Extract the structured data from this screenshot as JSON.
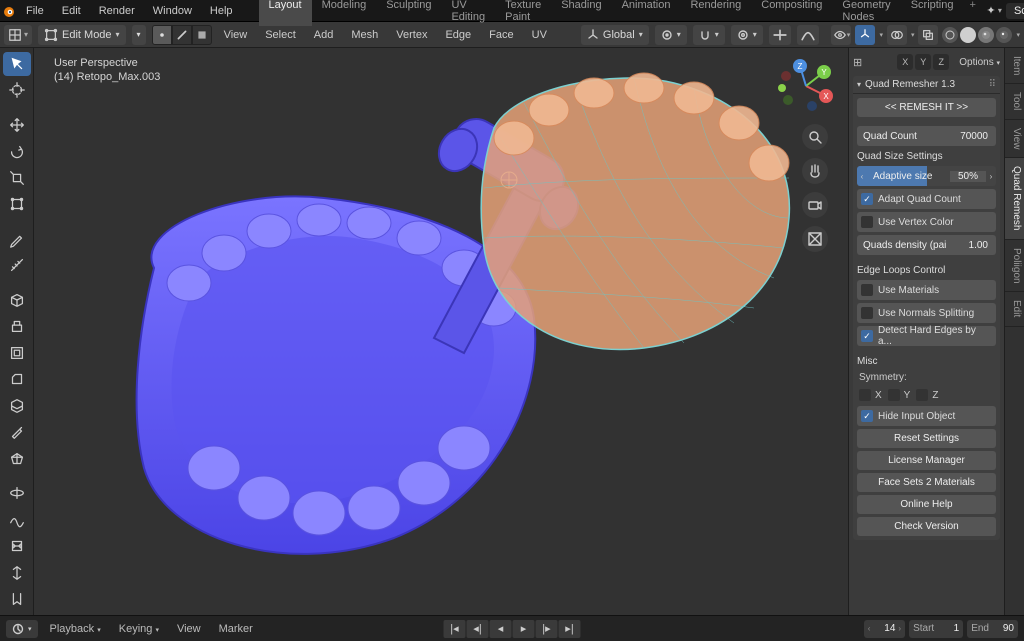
{
  "top_menu": [
    "File",
    "Edit",
    "Render",
    "Window",
    "Help"
  ],
  "workspaces": [
    "Layout",
    "Modeling",
    "Sculpting",
    "UV Editing",
    "Texture Paint",
    "Shading",
    "Animation",
    "Rendering",
    "Compositing",
    "Geometry Nodes",
    "Scripting"
  ],
  "workspace_active": "Layout",
  "scene": {
    "label": "Scene"
  },
  "tool_header": {
    "mode": "Edit Mode",
    "menus": [
      "View",
      "Select",
      "Add",
      "Mesh",
      "Vertex",
      "Edge",
      "Face",
      "UV"
    ],
    "orientation": "Global",
    "options_label": "Options"
  },
  "viewport": {
    "line1": "User Perspective",
    "line2": "(14) Retopo_Max.003"
  },
  "axis_labels": [
    "X",
    "Y",
    "Z"
  ],
  "n_panel": {
    "tabs": [
      "Item",
      "Tool",
      "View",
      "Quad Remesh",
      "Poliigon",
      "Edit"
    ],
    "active_tab": "Quad Remesh",
    "header": "Quad Remesher 1.3",
    "remesh_btn": "<<  REMESH IT  >>",
    "quad_count": {
      "label": "Quad Count",
      "value": "70000"
    },
    "quad_size_title": "Quad Size Settings",
    "adaptive": {
      "label": "Adaptive size",
      "value": "50%",
      "fill": 50
    },
    "adapt_count": "Adapt Quad Count",
    "use_vertex": "Use Vertex Color",
    "density": {
      "label": "Quads density (pai",
      "value": "1.00"
    },
    "edge_loops_title": "Edge Loops Control",
    "use_materials": "Use Materials",
    "use_normals": "Use Normals Splitting",
    "detect_hard": "Detect Hard Edges by a...",
    "misc_title": "Misc",
    "symmetry_label": "Symmetry:",
    "sym_axes": [
      "X",
      "Y",
      "Z"
    ],
    "hide_input": "Hide Input Object",
    "buttons": [
      "Reset Settings",
      "License Manager",
      "Face Sets 2 Materials",
      "Online Help",
      "Check Version"
    ]
  },
  "timeline": {
    "playback": "Playback",
    "keying": "Keying",
    "view": "View",
    "marker": "Marker",
    "current": {
      "value": "14"
    },
    "start": {
      "label": "Start",
      "value": "1"
    },
    "end": {
      "label": "End",
      "value": "90"
    }
  }
}
